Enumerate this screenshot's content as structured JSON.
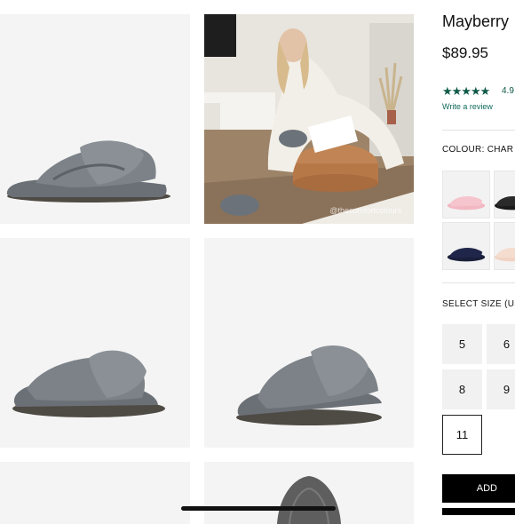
{
  "product": {
    "name": "Mayberry",
    "price": "$89.95",
    "stars": "★★★★★",
    "rating": "4.9",
    "review_link": "Write a review"
  },
  "gallery": {
    "lifestyle_caption": "@thecomfortcolours",
    "images": [
      "slipper-side",
      "lifestyle-photo",
      "slipper-front",
      "slipper-angle",
      "slipper-sole",
      "lifestyle-partial"
    ]
  },
  "colour": {
    "label": "COLOUR: CHAR",
    "swatches": [
      {
        "name": "pink",
        "color": "#f2b8c2"
      },
      {
        "name": "black",
        "color": "#1a1a1a"
      },
      {
        "name": "navy",
        "color": "#1a1f3a"
      },
      {
        "name": "nude",
        "color": "#f0d3c4"
      }
    ]
  },
  "size": {
    "label": "SELECT SIZE (US",
    "options": [
      "5",
      "6",
      "8",
      "9",
      "11"
    ],
    "selected": "11"
  },
  "actions": {
    "add_label": "ADD"
  },
  "colors": {
    "accent": "#0f5a48",
    "slipper_fur": "#6f757b",
    "button": "#000000"
  }
}
